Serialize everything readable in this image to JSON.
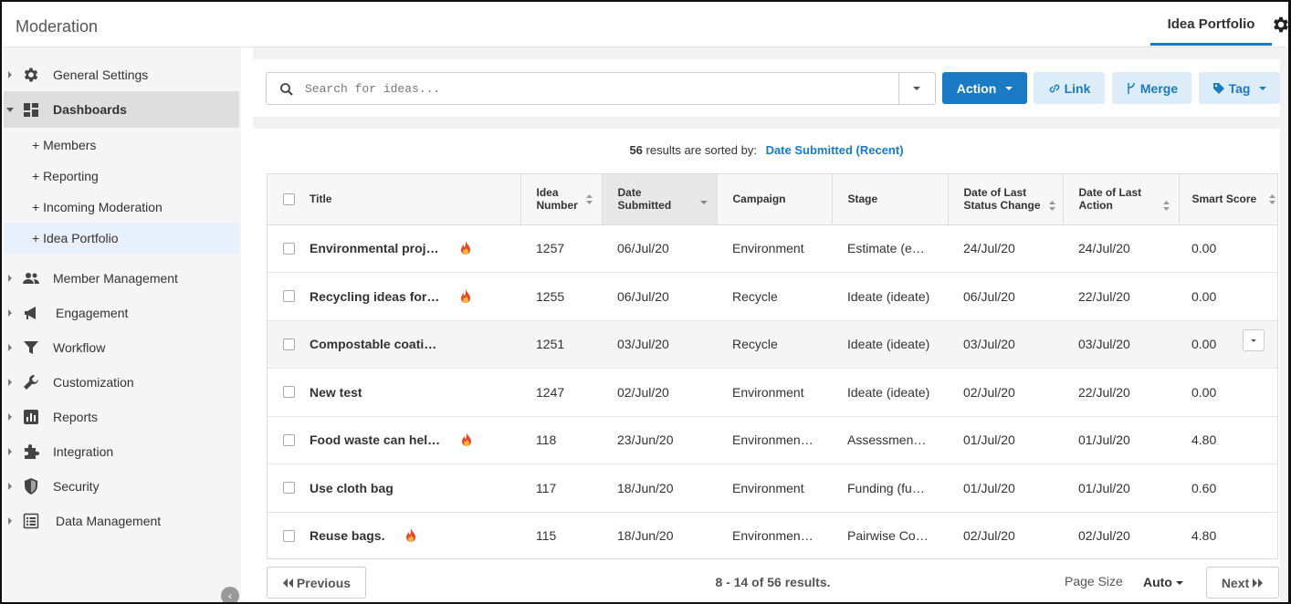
{
  "app": {
    "title": "Moderation"
  },
  "header": {
    "tab_label": "Idea Portfolio"
  },
  "sidebar": {
    "items": [
      {
        "label": "General Settings"
      },
      {
        "label": "Dashboards"
      },
      {
        "label": "Member Management"
      },
      {
        "label": "Engagement"
      },
      {
        "label": "Workflow"
      },
      {
        "label": "Customization"
      },
      {
        "label": "Reports"
      },
      {
        "label": "Integration"
      },
      {
        "label": "Security"
      },
      {
        "label": "Data Management"
      }
    ],
    "sub_items": [
      {
        "label": "+ Members"
      },
      {
        "label": "+ Reporting"
      },
      {
        "label": "+ Incoming Moderation"
      },
      {
        "label": "+ Idea Portfolio"
      }
    ]
  },
  "toolbar": {
    "search_placeholder": "Search for ideas...",
    "action_label": "Action",
    "link_label": "Link",
    "merge_label": "Merge",
    "tag_label": "Tag"
  },
  "results": {
    "count": "56",
    "sort_text": "results are sorted by:",
    "sort_value": "Date Submitted (Recent)"
  },
  "table": {
    "headers": {
      "title": "Title",
      "idea_number_1": "Idea",
      "idea_number_2": "Number",
      "date_submitted_1": "Date",
      "date_submitted_2": "Submitted",
      "campaign": "Campaign",
      "stage": "Stage",
      "status_change_1": "Date of Last",
      "status_change_2": "Status Change",
      "last_action_1": "Date of Last",
      "last_action_2": "Action",
      "smart_score": "Smart Score"
    },
    "rows": [
      {
        "title": "Environmental proj…",
        "hot": true,
        "number": "1257",
        "submitted": "06/Jul/20",
        "campaign": "Environment",
        "stage": "Estimate (e…",
        "status_change": "24/Jul/20",
        "last_action": "24/Jul/20",
        "score": "0.00"
      },
      {
        "title": "Recycling ideas for…",
        "hot": true,
        "number": "1255",
        "submitted": "06/Jul/20",
        "campaign": "Recycle",
        "stage": "Ideate (ideate)",
        "status_change": "06/Jul/20",
        "last_action": "22/Jul/20",
        "score": "0.00"
      },
      {
        "title": "Compostable coati…",
        "hot": false,
        "number": "1251",
        "submitted": "03/Jul/20",
        "campaign": "Recycle",
        "stage": "Ideate (ideate)",
        "status_change": "03/Jul/20",
        "last_action": "03/Jul/20",
        "score": "0.00"
      },
      {
        "title": "New test",
        "hot": false,
        "number": "1247",
        "submitted": "02/Jul/20",
        "campaign": "Environment",
        "stage": "Ideate (ideate)",
        "status_change": "02/Jul/20",
        "last_action": "22/Jul/20",
        "score": "0.00"
      },
      {
        "title": "Food waste can hel…",
        "hot": true,
        "number": "118",
        "submitted": "23/Jun/20",
        "campaign": "Environmen…",
        "stage": "Assessmen…",
        "status_change": "01/Jul/20",
        "last_action": "01/Jul/20",
        "score": "4.80"
      },
      {
        "title": "Use cloth bag",
        "hot": false,
        "number": "117",
        "submitted": "18/Jun/20",
        "campaign": "Environment",
        "stage": "Funding (fu…",
        "status_change": "01/Jul/20",
        "last_action": "01/Jul/20",
        "score": "0.60"
      },
      {
        "title": "Reuse bags.",
        "hot": true,
        "number": "115",
        "submitted": "18/Jun/20",
        "campaign": "Environmen…",
        "stage": "Pairwise Co…",
        "status_change": "02/Jul/20",
        "last_action": "02/Jul/20",
        "score": "4.80"
      }
    ]
  },
  "pager": {
    "prev_label": "Previous",
    "next_label": "Next",
    "summary": "8 - 14 of 56 results.",
    "page_size_label": "Page Size",
    "page_size_value": "Auto"
  },
  "colors": {
    "accent": "#1a7ac4",
    "accent_light": "#dcecf9",
    "sidebar_bg": "#f5f5f5",
    "active_bg": "#dedede"
  }
}
